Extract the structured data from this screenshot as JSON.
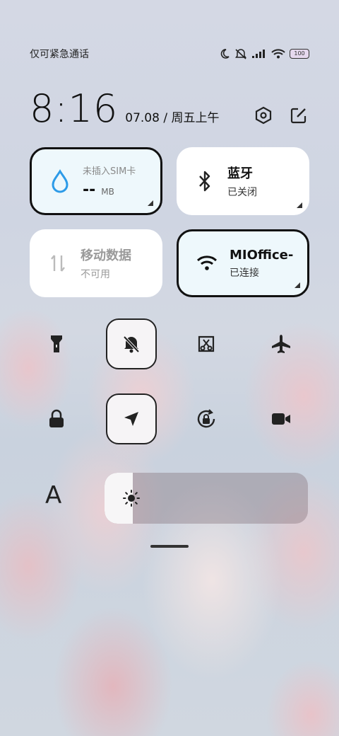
{
  "status_bar": {
    "carrier_text": "仅可紧急通话",
    "battery_level": "100",
    "icons": [
      "moon-icon",
      "mute-icon",
      "signal-icon",
      "wifi-icon",
      "battery-icon"
    ]
  },
  "header": {
    "time": "8:16",
    "date": "07.08 / 周五上午",
    "actions": [
      "settings-icon",
      "edit-icon"
    ]
  },
  "tiles": {
    "sim": {
      "title": "未插入SIM卡",
      "value": "--",
      "unit": "MB",
      "icon": "water-drop-icon",
      "active": true
    },
    "bluetooth": {
      "title": "蓝牙",
      "status": "已关闭",
      "icon": "bluetooth-icon",
      "active": false
    },
    "mobile_data": {
      "title": "移动数据",
      "status": "不可用",
      "icon": "data-arrows-icon",
      "active": false
    },
    "wifi": {
      "title": "MIOffice-",
      "status": "已连接",
      "icon": "wifi-icon",
      "active": true
    }
  },
  "quick_toggles": [
    {
      "name": "flashlight-icon",
      "active": false
    },
    {
      "name": "mute-bell-icon",
      "active": true
    },
    {
      "name": "screenshot-icon",
      "active": false
    },
    {
      "name": "airplane-icon",
      "active": false
    },
    {
      "name": "lock-icon",
      "active": false
    },
    {
      "name": "location-icon",
      "active": true
    },
    {
      "name": "rotation-lock-icon",
      "active": false
    },
    {
      "name": "video-camera-icon",
      "active": false
    }
  ],
  "font_button_label": "A",
  "brightness": {
    "level": 0.14
  },
  "colors": {
    "active_tile_bg": "#eef8fc",
    "accent_blue": "#2d9be8"
  }
}
